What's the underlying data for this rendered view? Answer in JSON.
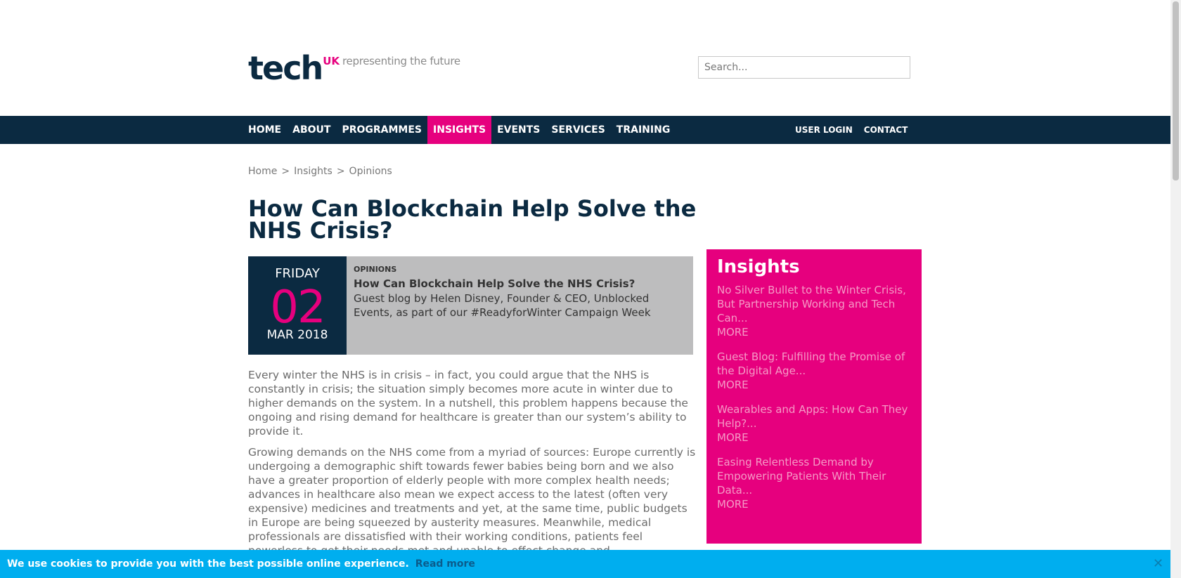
{
  "logo": {
    "tech": "tech",
    "uk": "UK",
    "tagline": "representing the future"
  },
  "search": {
    "placeholder": "Search..."
  },
  "nav": {
    "items": [
      "HOME",
      "ABOUT",
      "PROGRAMMES",
      "INSIGHTS",
      "EVENTS",
      "SERVICES",
      "TRAINING"
    ],
    "active": "INSIGHTS",
    "right": [
      "USER LOGIN",
      "CONTACT"
    ]
  },
  "breadcrumb": {
    "home": "Home",
    "sep": ">",
    "insights": "Insights",
    "opinions": "Opinions"
  },
  "article": {
    "title": "How Can Blockchain Help Solve the NHS Crisis?",
    "date": {
      "weekday": "FRIDAY",
      "day": "02",
      "month_year": "MAR 2018"
    },
    "category": "OPINIONS",
    "card_title": "How Can Blockchain Help Solve the NHS Crisis?",
    "card_subtitle": "Guest blog by Helen Disney, Founder & CEO, Unblocked Events, as part of our #ReadyforWinter Campaign Week",
    "paragraphs": [
      "Every winter the NHS is in crisis – in fact, you could argue that the NHS is constantly in crisis; the situation simply becomes more acute in winter due to higher demands on the system. In a nutshell, this problem happens because the ongoing and rising demand for healthcare is greater than our system’s ability to provide it.",
      "Growing demands on the NHS come from a myriad of sources: Europe currently is undergoing a demographic shift towards fewer babies being born and we also have a greater proportion of elderly people with more complex health needs; advances in healthcare also mean we expect access to the latest (often very expensive) medicines and treatments and yet, at the same time, public budgets in Europe are being squeezed by austerity measures. Meanwhile, medical professionals are dissatisfied with their working conditions, patients feel powerless to get their needs met and unable to effect change and"
    ]
  },
  "sidebar": {
    "title": "Insights",
    "more_label": "MORE",
    "items": [
      "No Silver Bullet to the Winter Crisis, But Partnership Working and Tech Can...",
      "Guest Blog: Fulfilling the Promise of the Digital Age...",
      "Wearables and Apps: How Can They Help?...",
      "Easing Relentless Demand by Empowering Patients With Their Data..."
    ]
  },
  "cookie": {
    "text": "We use cookies to provide you with the best possible online experience.",
    "link": "Read more",
    "close": "✕"
  },
  "colors": {
    "navy": "#0b2a41",
    "magenta": "#e6007e",
    "cookie_blue": "#00aeef",
    "card_grey": "#bdbdbe"
  }
}
